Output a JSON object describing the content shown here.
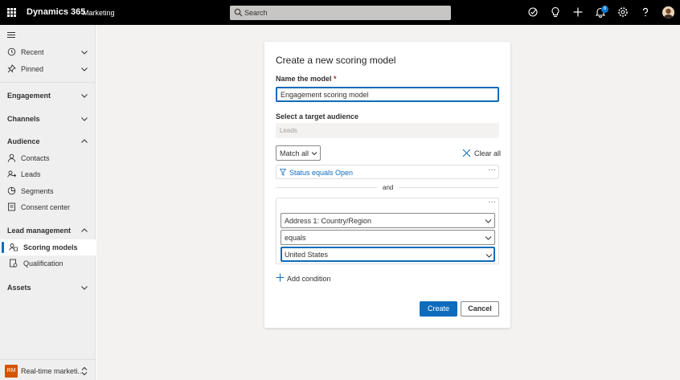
{
  "topbar": {
    "app_title": "Dynamics 365",
    "app_area": "Marketing",
    "search_placeholder": "Search",
    "notification_count": "8"
  },
  "sidebar": {
    "items_top": [
      {
        "label": "Recent",
        "icon": "clock-icon"
      },
      {
        "label": "Pinned",
        "icon": "pin-icon"
      }
    ],
    "groups": {
      "engagement": "Engagement",
      "channels": "Channels",
      "audience": "Audience",
      "lead_management": "Lead management",
      "assets": "Assets"
    },
    "audience_items": [
      {
        "label": "Contacts",
        "icon": "person-icon"
      },
      {
        "label": "Leads",
        "icon": "leads-icon"
      },
      {
        "label": "Segments",
        "icon": "segments-icon"
      },
      {
        "label": "Consent center",
        "icon": "consent-icon"
      }
    ],
    "lead_items": [
      {
        "label": "Scoring models",
        "icon": "scoring-icon",
        "active": true
      },
      {
        "label": "Qualification",
        "icon": "qualification-icon"
      }
    ],
    "area_switcher": {
      "initials": "RM",
      "label": "Real-time marketi..."
    }
  },
  "dialog": {
    "title": "Create a new scoring model",
    "name_label": "Name the model",
    "required_marker": "*",
    "name_value": "Engagement scoring model",
    "audience_label": "Select a target audience",
    "audience_value": "Leads",
    "match_label": "Match all",
    "clear_all": "Clear all",
    "condition_1": "Status equals Open",
    "more": "···",
    "and_label": "and",
    "condition_group": {
      "attribute": "Address 1: Country/Region",
      "operator": "equals",
      "value": "United States"
    },
    "add_condition": "Add condition",
    "create_label": "Create",
    "cancel_label": "Cancel"
  },
  "colors": {
    "accent": "#0f6cbd",
    "topbar": "#000000",
    "sidebar": "#efefef",
    "area_badge": "#d35400"
  }
}
